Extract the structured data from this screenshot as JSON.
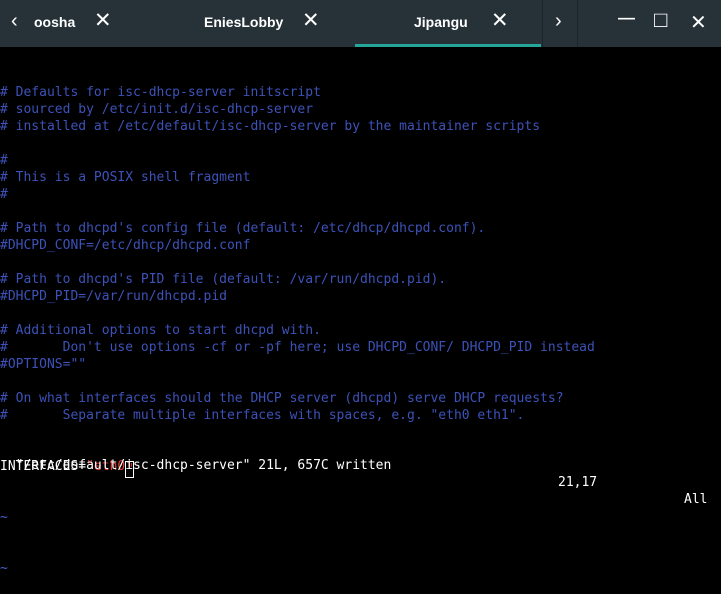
{
  "tabs": [
    {
      "label": "oosha",
      "close": "✕"
    },
    {
      "label": "EniesLobby",
      "close": "✕"
    },
    {
      "label": "Jipangu",
      "close": "✕"
    }
  ],
  "nav": {
    "prev": "‹",
    "next": "›"
  },
  "window": {
    "minimize": "—",
    "maximize": "□",
    "close": "✕"
  },
  "colors": {
    "tabbar": "#263238",
    "accent": "#26a69a",
    "comment": "#3d52b8",
    "string": "#e53935"
  },
  "editor": {
    "lines": [
      {
        "type": "comment",
        "text": "# Defaults for isc-dhcp-server initscript"
      },
      {
        "type": "comment",
        "text": "# sourced by /etc/init.d/isc-dhcp-server"
      },
      {
        "type": "comment",
        "text": "# installed at /etc/default/isc-dhcp-server by the maintainer scripts"
      },
      {
        "type": "blank",
        "text": ""
      },
      {
        "type": "comment",
        "text": "#"
      },
      {
        "type": "comment",
        "text": "# This is a POSIX shell fragment"
      },
      {
        "type": "comment",
        "text": "#"
      },
      {
        "type": "blank",
        "text": ""
      },
      {
        "type": "comment",
        "text": "# Path to dhcpd's config file (default: /etc/dhcp/dhcpd.conf)."
      },
      {
        "type": "comment",
        "text": "#DHCPD_CONF=/etc/dhcp/dhcpd.conf"
      },
      {
        "type": "blank",
        "text": ""
      },
      {
        "type": "comment",
        "text": "# Path to dhcpd's PID file (default: /var/run/dhcpd.pid)."
      },
      {
        "type": "comment",
        "text": "#DHCPD_PID=/var/run/dhcpd.pid"
      },
      {
        "type": "blank",
        "text": ""
      },
      {
        "type": "comment",
        "text": "# Additional options to start dhcpd with."
      },
      {
        "type": "comment",
        "text": "#       Don't use options -cf or -pf here; use DHCPD_CONF/ DHCPD_PID instead"
      },
      {
        "type": "comment",
        "text": "#OPTIONS=\"\""
      },
      {
        "type": "blank",
        "text": ""
      },
      {
        "type": "comment",
        "text": "# On what interfaces should the DHCP server (dhcpd) serve DHCP requests?"
      },
      {
        "type": "comment",
        "text": "#       Separate multiple interfaces with spaces, e.g. \"eth0 eth1\"."
      }
    ],
    "interfaces_line": {
      "key": "INTERFACES=",
      "value": "\"eth0",
      "cursor_char": "\""
    },
    "tildes": [
      "~",
      "~"
    ]
  },
  "status": {
    "message": "\"/etc/default/isc-dhcp-server\" 21L, 657C written",
    "position": "21,17",
    "percent": "All"
  }
}
